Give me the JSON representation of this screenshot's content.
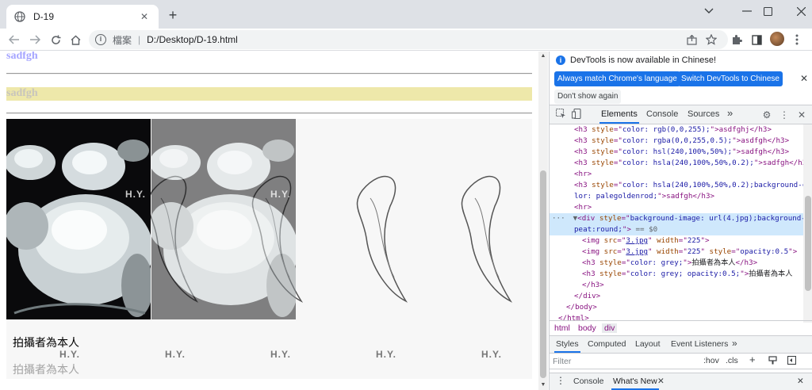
{
  "browser": {
    "tab_title": "D-19",
    "new_tab": "+",
    "security_label": "檔案",
    "url": "D:/Desktop/D-19.html"
  },
  "page": {
    "h3_top": "sadfgh",
    "h3_top_color": "#a5a5ff",
    "h3_golden": "sadfgh",
    "h3_golden_bg": "#eee8aa",
    "caption_1": "拍攝者為本人",
    "caption_2": "拍攝者為本人",
    "watermark": "H.Y."
  },
  "devtools": {
    "banner_message": "DevTools is now available in Chinese!",
    "btn_match": "Always match Chrome's language",
    "btn_switch": "Switch DevTools to Chinese",
    "btn_dont_show": "Don't show again",
    "tabs": [
      "Elements",
      "Console",
      "Sources"
    ],
    "more_tabs": "»",
    "breadcrumbs": [
      "html",
      "body",
      "div"
    ],
    "styles_tabs": [
      "Styles",
      "Computed",
      "Layout",
      "Event Listeners"
    ],
    "filter_placeholder": "Filter",
    "hov": ":hov",
    "cls": ".cls",
    "drawer_tabs": [
      "Console",
      "What's New"
    ],
    "code": {
      "l1": [
        "<h3 ",
        "style",
        "=\"",
        "color: rgb(0,0,255);",
        "\">asdfghj</h3>"
      ],
      "l2": [
        "<h3 ",
        "style",
        "=\"",
        "color: rgba(0,0,255,0.5);",
        "\">asdfgh</h3>"
      ],
      "l3": [
        "<h3 ",
        "style",
        "=\"",
        "color: hsl(240,100%,50%);",
        "\">sadfgh</h3>"
      ],
      "l4": [
        "<h3 ",
        "style",
        "=\"",
        "color: hsla(240,100%,50%,0.2);",
        "\">sadfgh</h3>"
      ],
      "l5": "<hr>",
      "l6a": [
        "<h3 ",
        "style",
        "=\"",
        "color: hsla(240,100%,50%,0.2);background-co"
      ],
      "l6b": [
        "lor: palegoldenrod;",
        "\">sadfgh</h3>"
      ],
      "l7": "<hr>",
      "l8a": [
        "<div ",
        "style",
        "=\"",
        "background-image: url(4.jpg);background-re"
      ],
      "l8b": [
        "peat:round;",
        "\">",
        " == $0"
      ],
      "l9": [
        "<img ",
        "src",
        "=\"",
        "3.jpg",
        "\" ",
        "width",
        "=\"",
        "225",
        "\">"
      ],
      "l10": [
        "<img ",
        "src",
        "=\"",
        "3.jpg",
        "\" ",
        "width",
        "=\"",
        "225",
        "\" ",
        "style",
        "=\"",
        "opacity:0.5",
        "\">"
      ],
      "l11": [
        "<h3 ",
        "style",
        "=\"",
        "color: grey;",
        "\">",
        "拍攝者為本人",
        "</h3>"
      ],
      "l12": [
        "<h3 ",
        "style",
        "=\"",
        "color: grey; opacity:0.5;",
        "\">",
        "拍攝者為本人"
      ],
      "l13": "</h3>",
      "l14": "</div>",
      "l15": "</body>",
      "l16": "</html>"
    }
  }
}
